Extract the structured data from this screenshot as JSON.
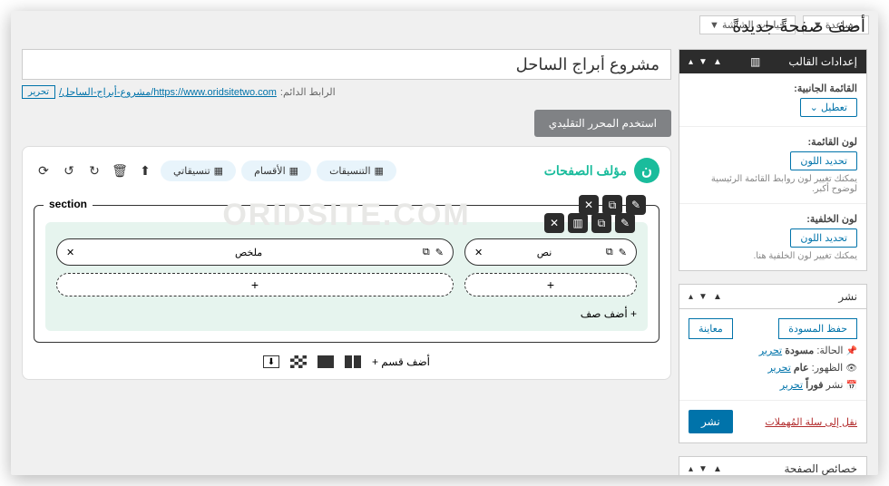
{
  "topbar": {
    "screen_options": "خيارات الشاشة ▼",
    "help": "مساعدة ▼"
  },
  "heading": "أضف صفحةً جديدةً",
  "title": "مشروع أبراج الساحل",
  "permalink": {
    "label": "الرابط الدائم:",
    "url": "https://www.oridsitetwo.com/مشروع-أبراج-الساحل/",
    "edit": "تحرير"
  },
  "classic_editor_btn": "استخدم المحرر التقليدي",
  "builder": {
    "brand": "مؤلف الصفحات",
    "tabs": {
      "templates": "التنسيقات",
      "sections": "الأقسام",
      "my_templates": "تنسيقاتي"
    },
    "watermark": "ORIDSITE.COM",
    "section_label": "section",
    "elements": {
      "text": "نص",
      "summary": "ملخص"
    },
    "add_row": "+ أضف صف",
    "add_section": "أضف قسم +"
  },
  "sidebar": {
    "theme": {
      "title": "إعدادات القالب",
      "side_menu_label": "القائمة الجانبية:",
      "side_menu_value": "تعطيل ⌄",
      "menu_color_label": "لون القائمة:",
      "color_btn": "تحديد اللون",
      "menu_hint": "يمكنك تغيير لون روابط القائمة الرئيسية لوضوح أكبر.",
      "bg_color_label": "لون الخلفية:",
      "bg_hint": "يمكنك تغيير لون الخلفية هنا."
    },
    "publish": {
      "title": "نشر",
      "save_draft": "حفظ المسودة",
      "preview": "معاينة",
      "status_label": "الحالة:",
      "status_value": "مسودة",
      "status_edit": "تحرير",
      "visibility_label": "الظهور:",
      "visibility_value": "عام",
      "visibility_edit": "تحرير",
      "schedule_label": "نشر",
      "schedule_value": "فوراً",
      "schedule_edit": "تحرير",
      "trash": "نقل إلى سلة المُهملات",
      "publish_btn": "نشر"
    },
    "attributes": {
      "title": "خصائص الصفحة"
    }
  }
}
